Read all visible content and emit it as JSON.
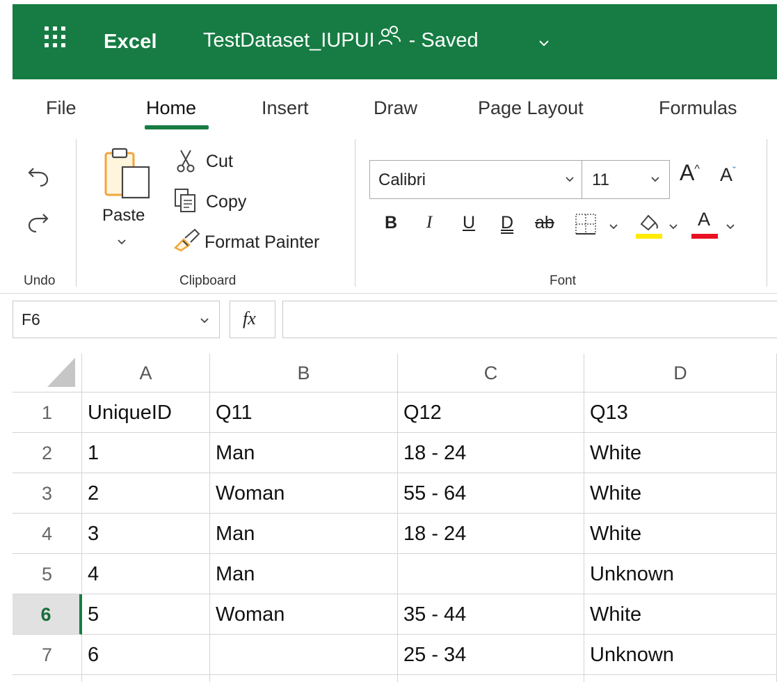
{
  "title_bar": {
    "app_name": "Excel",
    "doc_title": "TestDataset_IUPUI",
    "save_status": "- Saved",
    "brand_color": "#167C43"
  },
  "ribbon": {
    "tabs": [
      "File",
      "Home",
      "Insert",
      "Draw",
      "Page Layout",
      "Formulas"
    ],
    "active_tab": "Home",
    "undo_label": "Undo",
    "clipboard": {
      "paste_label": "Paste",
      "cut_label": "Cut",
      "copy_label": "Copy",
      "format_painter_label": "Format Painter",
      "group_label": "Clipboard"
    },
    "font": {
      "font_name": "Calibri",
      "font_size": "11",
      "group_label": "Font",
      "bold": "B",
      "italic": "I",
      "underline": "U",
      "double_underline": "D",
      "strikethrough": "ab",
      "fill_color": "#FFEB00",
      "font_color": "#E81123",
      "font_color_letter": "A",
      "grow_letter": "A",
      "shrink_letter": "A"
    }
  },
  "formula_bar": {
    "cell_ref": "F6",
    "fx_label": "fx",
    "formula": ""
  },
  "sheet": {
    "columns": [
      "A",
      "B",
      "C",
      "D"
    ],
    "active_row": "6",
    "rows": [
      {
        "num": "1",
        "cells": [
          "UniqueID",
          "Q11",
          "Q12",
          "Q13"
        ]
      },
      {
        "num": "2",
        "cells": [
          "1",
          "Man",
          "18 - 24",
          "White"
        ]
      },
      {
        "num": "3",
        "cells": [
          "2",
          "Woman",
          "55 - 64",
          "White"
        ]
      },
      {
        "num": "4",
        "cells": [
          "3",
          "Man",
          "18 - 24",
          "White"
        ]
      },
      {
        "num": "5",
        "cells": [
          "4",
          "Man",
          "",
          "Unknown"
        ]
      },
      {
        "num": "6",
        "cells": [
          "5",
          "Woman",
          "35 - 44",
          "White"
        ]
      },
      {
        "num": "7",
        "cells": [
          "6",
          "",
          "25 - 34",
          "Unknown"
        ]
      }
    ]
  }
}
